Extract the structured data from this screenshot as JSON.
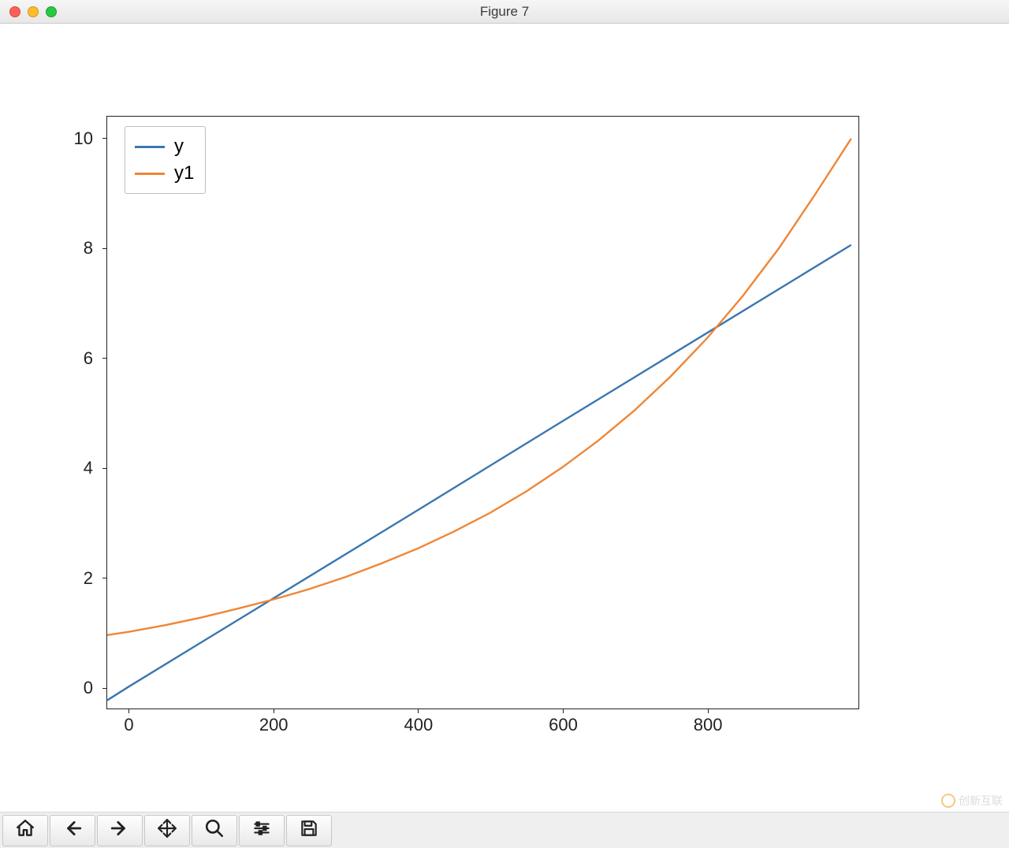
{
  "window": {
    "title": "Figure 7"
  },
  "toolbar": {
    "buttons": [
      {
        "name": "home-button",
        "icon": "home-icon"
      },
      {
        "name": "back-button",
        "icon": "arrow-left-icon"
      },
      {
        "name": "forward-button",
        "icon": "arrow-right-icon"
      },
      {
        "name": "pan-button",
        "icon": "move-icon"
      },
      {
        "name": "zoom-button",
        "icon": "magnifier-icon"
      },
      {
        "name": "configure-button",
        "icon": "sliders-icon"
      },
      {
        "name": "save-button",
        "icon": "save-icon"
      }
    ]
  },
  "watermark": {
    "text": "创新互联"
  },
  "chart_data": {
    "type": "line",
    "title": "",
    "xlabel": "",
    "ylabel": "",
    "xlim": [
      -30,
      1010
    ],
    "ylim": [
      -0.4,
      10.4
    ],
    "xticks": [
      0,
      200,
      400,
      600,
      800
    ],
    "yticks": [
      0,
      2,
      4,
      6,
      8,
      10
    ],
    "legend": {
      "position": "upper left",
      "labels": [
        "y",
        "y1"
      ]
    },
    "x_domain": [
      -30,
      1000
    ],
    "series": [
      {
        "name": "y",
        "color": "#3a77af",
        "x": [
          -30,
          0,
          200,
          400,
          600,
          800,
          1000
        ],
        "y": [
          -0.25,
          0,
          1.61,
          3.22,
          4.84,
          6.45,
          8.06
        ]
      },
      {
        "name": "y1",
        "color": "#ef8636",
        "x": [
          -30,
          0,
          50,
          100,
          150,
          200,
          250,
          300,
          350,
          400,
          450,
          500,
          550,
          600,
          650,
          700,
          750,
          800,
          850,
          900,
          950,
          1000
        ],
        "y": [
          0.94,
          1.0,
          1.12,
          1.26,
          1.42,
          1.59,
          1.78,
          2.0,
          2.25,
          2.52,
          2.83,
          3.17,
          3.56,
          4.0,
          4.49,
          5.04,
          5.66,
          6.35,
          7.13,
          8.0,
          8.98,
          10.0
        ]
      }
    ]
  }
}
